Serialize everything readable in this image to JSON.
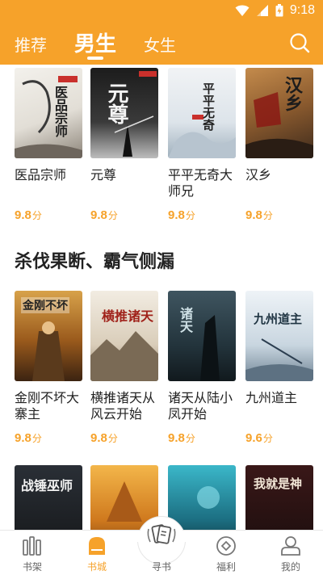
{
  "status": {
    "time": "9:18"
  },
  "tabs": [
    {
      "label": "推荐"
    },
    {
      "label": "男生"
    },
    {
      "label": "女生"
    }
  ],
  "colors": {
    "accent": "#f6a22a"
  },
  "row1": [
    {
      "title": "医品宗师",
      "score": "9.8",
      "unit": "分",
      "cover_text": "医品宗师"
    },
    {
      "title": "元尊",
      "score": "9.8",
      "unit": "分",
      "cover_text": "元尊"
    },
    {
      "title": "平平无奇大师兄",
      "score": "9.8",
      "unit": "分",
      "cover_text": "平平无奇"
    },
    {
      "title": "汉乡",
      "score": "9.8",
      "unit": "分",
      "cover_text": "汉乡"
    }
  ],
  "section": {
    "title": "杀伐果断、霸气侧漏"
  },
  "row2": [
    {
      "title": "金刚不坏大寨主",
      "score": "9.8",
      "unit": "分",
      "cover_text": "金刚不坏"
    },
    {
      "title": "横推诸天从风云开始",
      "score": "9.8",
      "unit": "分",
      "cover_text": "横推诸天"
    },
    {
      "title": "诸天从陆小凤开始",
      "score": "9.8",
      "unit": "分",
      "cover_text": "诸天"
    },
    {
      "title": "九州道主",
      "score": "9.6",
      "unit": "分",
      "cover_text": "九州道主"
    }
  ],
  "row3": [
    {
      "cover_text": "战锤巫师"
    },
    {
      "cover_text": ""
    },
    {
      "cover_text": ""
    },
    {
      "cover_text": "我就是神"
    }
  ],
  "nav": [
    {
      "label": "书架",
      "icon": "bookshelf-icon"
    },
    {
      "label": "书城",
      "icon": "bookstore-icon"
    },
    {
      "label": "寻书",
      "icon": "find-book-icon"
    },
    {
      "label": "福利",
      "icon": "welfare-icon"
    },
    {
      "label": "我的",
      "icon": "profile-icon"
    }
  ]
}
